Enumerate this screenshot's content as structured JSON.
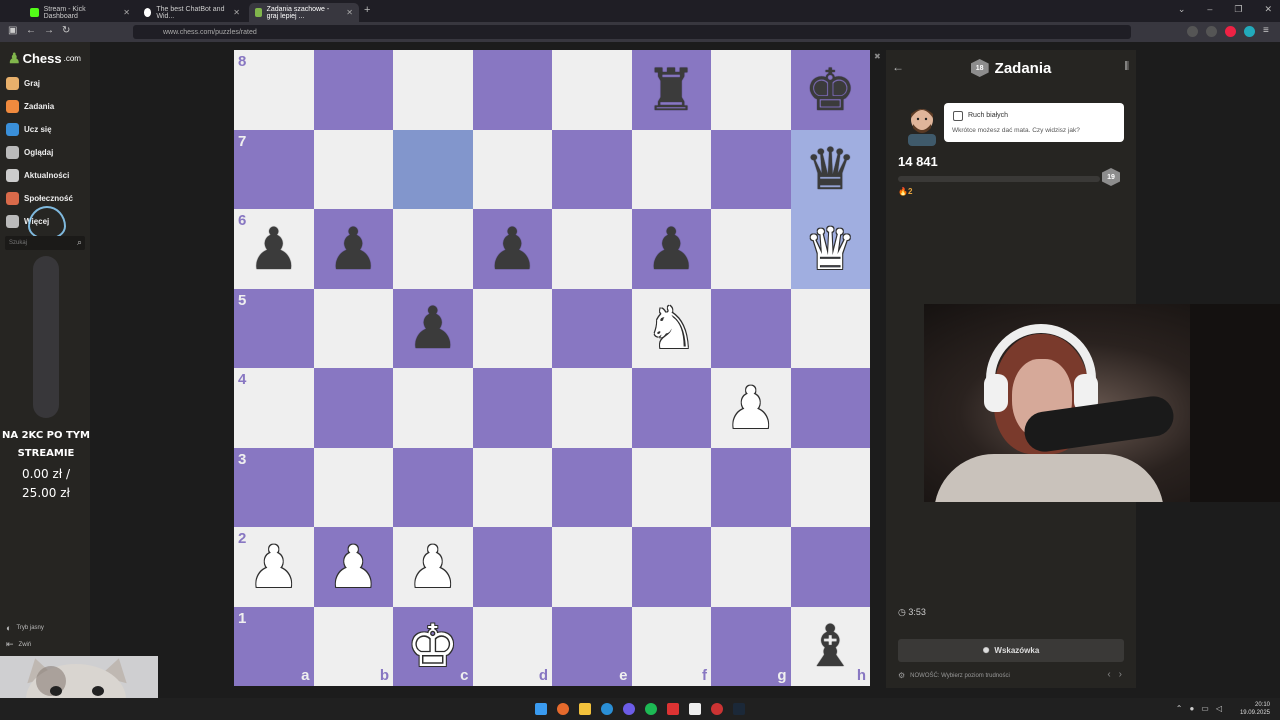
{
  "browser": {
    "tabs": [
      {
        "label": "Stream - Kick Dashboard",
        "icon": "kick-icon",
        "color": "#53fc18"
      },
      {
        "label": "The best ChatBot and Wid...",
        "icon": "chatbot-icon",
        "color": "#ffffff"
      },
      {
        "label": "Zadania szachowe - graj lepiej ...",
        "icon": "chess-favicon",
        "color": "#81b64c"
      }
    ],
    "url": "www.chess.com/puzzles/rated",
    "new_tab": "+"
  },
  "sidebar": {
    "logo": "Chess",
    "logo_suffix": ".com",
    "items": [
      {
        "label": "Graj",
        "icon": "play-icon",
        "color": "#e8b06b"
      },
      {
        "label": "Zadania",
        "icon": "puzzle-icon",
        "color": "#f08a3e"
      },
      {
        "label": "Ucz się",
        "icon": "learn-icon",
        "color": "#3a8fd9"
      },
      {
        "label": "Oglądaj",
        "icon": "watch-icon",
        "color": "#bbbbbb"
      },
      {
        "label": "Aktualności",
        "icon": "news-icon",
        "color": "#cccccc"
      },
      {
        "label": "Społeczność",
        "icon": "community-icon",
        "color": "#d96a4a"
      },
      {
        "label": "Więcej",
        "icon": "more-icon",
        "color": "#bbbbbb"
      }
    ],
    "search_placeholder": "Szukaj",
    "bottom": [
      {
        "label": "Tryb jasny",
        "icon": "theme-icon"
      },
      {
        "label": "Zwiń",
        "icon": "collapse-icon"
      }
    ]
  },
  "donation": {
    "line1": "NA 2KC PO TYM",
    "line2": "STREAMIE",
    "line3": "0.00 zł /",
    "line4": "25.00 zł"
  },
  "board": {
    "ranks": [
      "8",
      "7",
      "6",
      "5",
      "4",
      "3",
      "2",
      "1"
    ],
    "files": [
      "a",
      "b",
      "c",
      "d",
      "e",
      "f",
      "g",
      "h"
    ],
    "pieces": [
      {
        "sq": "f8",
        "glyph": "♜",
        "color": "b",
        "name": "black-rook"
      },
      {
        "sq": "h8",
        "glyph": "♚",
        "color": "b",
        "name": "black-king"
      },
      {
        "sq": "h7",
        "glyph": "♛",
        "color": "b",
        "name": "black-queen"
      },
      {
        "sq": "a6",
        "glyph": "♟",
        "color": "b",
        "name": "black-pawn"
      },
      {
        "sq": "b6",
        "glyph": "♟",
        "color": "b",
        "name": "black-pawn"
      },
      {
        "sq": "d6",
        "glyph": "♟",
        "color": "b",
        "name": "black-pawn"
      },
      {
        "sq": "f6",
        "glyph": "♟",
        "color": "b",
        "name": "black-pawn"
      },
      {
        "sq": "h6",
        "glyph": "♛",
        "color": "w",
        "name": "white-queen"
      },
      {
        "sq": "c5",
        "glyph": "♟",
        "color": "b",
        "name": "black-pawn"
      },
      {
        "sq": "f5",
        "glyph": "♞",
        "color": "w",
        "name": "white-knight"
      },
      {
        "sq": "g4",
        "glyph": "♟",
        "color": "w",
        "name": "white-pawn"
      },
      {
        "sq": "a2",
        "glyph": "♟",
        "color": "w",
        "name": "white-pawn"
      },
      {
        "sq": "b2",
        "glyph": "♟",
        "color": "w",
        "name": "white-pawn"
      },
      {
        "sq": "c2",
        "glyph": "♟",
        "color": "w",
        "name": "white-pawn"
      },
      {
        "sq": "c1",
        "glyph": "♚",
        "color": "w",
        "name": "white-king"
      },
      {
        "sq": "h1",
        "glyph": "♝",
        "color": "b",
        "name": "black-bishop"
      }
    ],
    "highlights": [
      "c7",
      "h7",
      "h6"
    ],
    "colors": {
      "light": "#efefef",
      "dark": "#8877c2"
    }
  },
  "panel": {
    "title": "Zadania",
    "title_badge": "18",
    "bubble_title": "Ruch białych",
    "bubble_text": "Wkrótce możesz dać mata. Czy widzisz jak?",
    "score": "14 841",
    "rank_badge": "19",
    "streak": "2",
    "streak_icon": "flame-icon",
    "progress_fraction": 0,
    "timer": "3:53",
    "hint_label": "Wskazówka",
    "news_text": "NOWOŚĆ: Wybierz poziom trudności"
  },
  "taskbar": {
    "time": "20:10",
    "date": "19.09.2025"
  }
}
